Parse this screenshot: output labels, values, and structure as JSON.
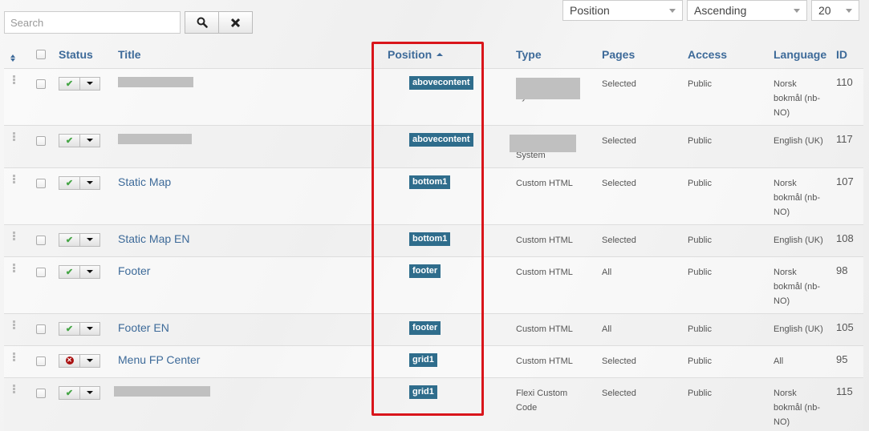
{
  "search": {
    "placeholder": "Search",
    "value": ""
  },
  "buttons": {
    "search_icon": "search-icon",
    "clear_icon": "close-icon"
  },
  "filters": {
    "sort_field": "Position",
    "sort_direction": "Ascending",
    "limit": "20"
  },
  "table": {
    "headers": {
      "ordering": "ordering-icon",
      "status": "Status",
      "title": "Title",
      "position": "Position",
      "type": "Type",
      "pages": "Pages",
      "access": "Access",
      "language": "Language",
      "id": "ID"
    },
    "sorted_by": "position",
    "sort_direction": "ascending",
    "rows": [
      {
        "status": "published",
        "title": "",
        "title_redacted": true,
        "position": "abovecontent",
        "type": "System",
        "type_redacted": true,
        "pages": "Selected",
        "access": "Public",
        "language": "Norsk bokmål (nb-NO)",
        "id": "110"
      },
      {
        "status": "published",
        "title": "",
        "title_redacted": true,
        "position": "abovecontent",
        "type": "System",
        "type_redacted": true,
        "pages": "Selected",
        "access": "Public",
        "language": "English (UK)",
        "id": "117"
      },
      {
        "status": "published",
        "title": "Static Map",
        "position": "bottom1",
        "type": "Custom HTML",
        "pages": "Selected",
        "access": "Public",
        "language": "Norsk bokmål (nb-NO)",
        "id": "107"
      },
      {
        "status": "published",
        "title": "Static Map EN",
        "position": "bottom1",
        "type": "Custom HTML",
        "pages": "Selected",
        "access": "Public",
        "language": "English (UK)",
        "id": "108"
      },
      {
        "status": "published",
        "title": "Footer",
        "position": "footer",
        "type": "Custom HTML",
        "pages": "All",
        "access": "Public",
        "language": "Norsk bokmål (nb-NO)",
        "id": "98"
      },
      {
        "status": "published",
        "title": "Footer EN",
        "position": "footer",
        "type": "Custom HTML",
        "pages": "All",
        "access": "Public",
        "language": "English (UK)",
        "id": "105"
      },
      {
        "status": "unpublished",
        "title": "Menu FP Center",
        "position": "grid1",
        "type": "Custom HTML",
        "pages": "Selected",
        "access": "Public",
        "language": "All",
        "id": "95"
      },
      {
        "status": "published",
        "title": "",
        "title_redacted": true,
        "position": "grid1",
        "type": "Flexi Custom Code",
        "pages": "Selected",
        "access": "Public",
        "language": "Norsk bokmål (nb-NO)",
        "id": "115"
      }
    ]
  },
  "colors": {
    "link": "#3d6a99",
    "badge": "#2f6d8c",
    "published": "#46a546",
    "unpublished": "#a11111",
    "highlight": "#d9151b"
  }
}
